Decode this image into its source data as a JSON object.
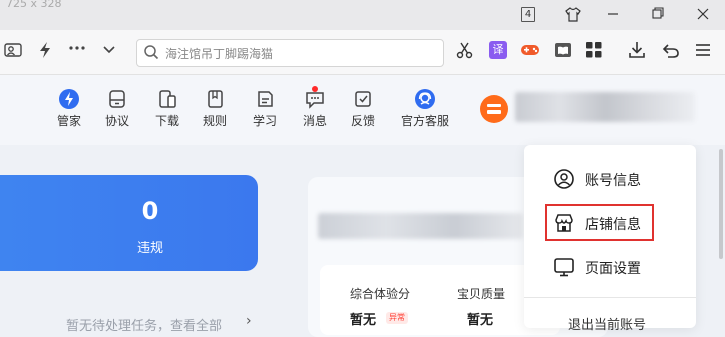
{
  "window": {
    "dimensions_label": "725 x 328",
    "tab_count": "4"
  },
  "toolbar": {
    "search_placeholder": "海注馆吊丁脚踢海猫",
    "translate_label": "译"
  },
  "nav": {
    "items": [
      {
        "label": "管家",
        "icon": "shield-lightning-icon"
      },
      {
        "label": "协议",
        "icon": "document-icon"
      },
      {
        "label": "下载",
        "icon": "phone-download-icon"
      },
      {
        "label": "规则",
        "icon": "book-icon"
      },
      {
        "label": "学习",
        "icon": "study-icon"
      },
      {
        "label": "消息",
        "icon": "message-icon"
      },
      {
        "label": "反馈",
        "icon": "feedback-icon"
      },
      {
        "label": "官方客服",
        "icon": "customer-service-icon"
      }
    ]
  },
  "violation_card": {
    "count": "0",
    "label": "违规"
  },
  "task_hint": {
    "text": "暂无待处理任务，查看全部",
    "arrow": "›"
  },
  "scores": {
    "items": [
      {
        "label": "综合体验分",
        "value": "暂无",
        "badge": "异常"
      },
      {
        "label": "宝贝质量",
        "value": "暂无"
      }
    ]
  },
  "dropdown": {
    "items": [
      {
        "label": "账号信息",
        "icon": "user-icon"
      },
      {
        "label": "店铺信息",
        "icon": "store-icon"
      },
      {
        "label": "页面设置",
        "icon": "monitor-icon"
      }
    ],
    "logout_label": "退出当前账号"
  },
  "colors": {
    "accent_blue": "#3b7cf0",
    "highlight_red": "#e0322f",
    "avatar_orange": "#ff6b1a",
    "notify_red": "#ff2a2a"
  }
}
